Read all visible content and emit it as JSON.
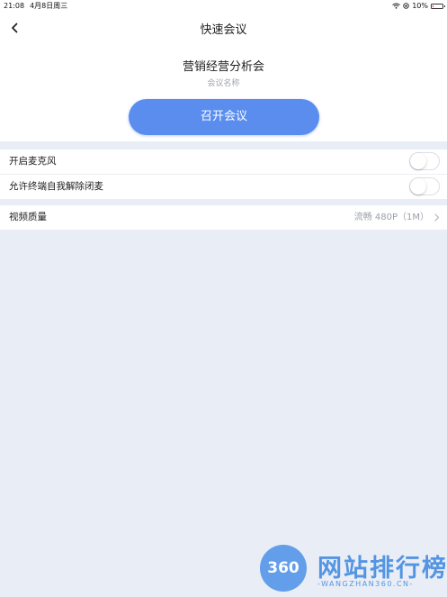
{
  "status_bar": {
    "time": "21:08",
    "date": "4月8日周三",
    "battery_text": "10%",
    "battery_level": 0.1,
    "battery_color": "#e53935"
  },
  "nav": {
    "title": "快速会议",
    "back_icon": "chevron-left-icon"
  },
  "meeting": {
    "name": "营销经营分析会",
    "name_caption": "会议名称",
    "start_button": "召开会议"
  },
  "settings": {
    "mic": {
      "label": "开启麦克风",
      "enabled": false
    },
    "self_unmute": {
      "label": "允许终端自我解除闭麦",
      "enabled": false
    },
    "video_quality": {
      "label": "视频质量",
      "value": "流畅 480P（1M）"
    }
  },
  "watermark": {
    "logo": "360",
    "title": "网站排行榜",
    "subtitle": "-WANGZHAN360.CN-"
  },
  "colors": {
    "accent": "#5b8def",
    "background": "#e9edf5"
  }
}
